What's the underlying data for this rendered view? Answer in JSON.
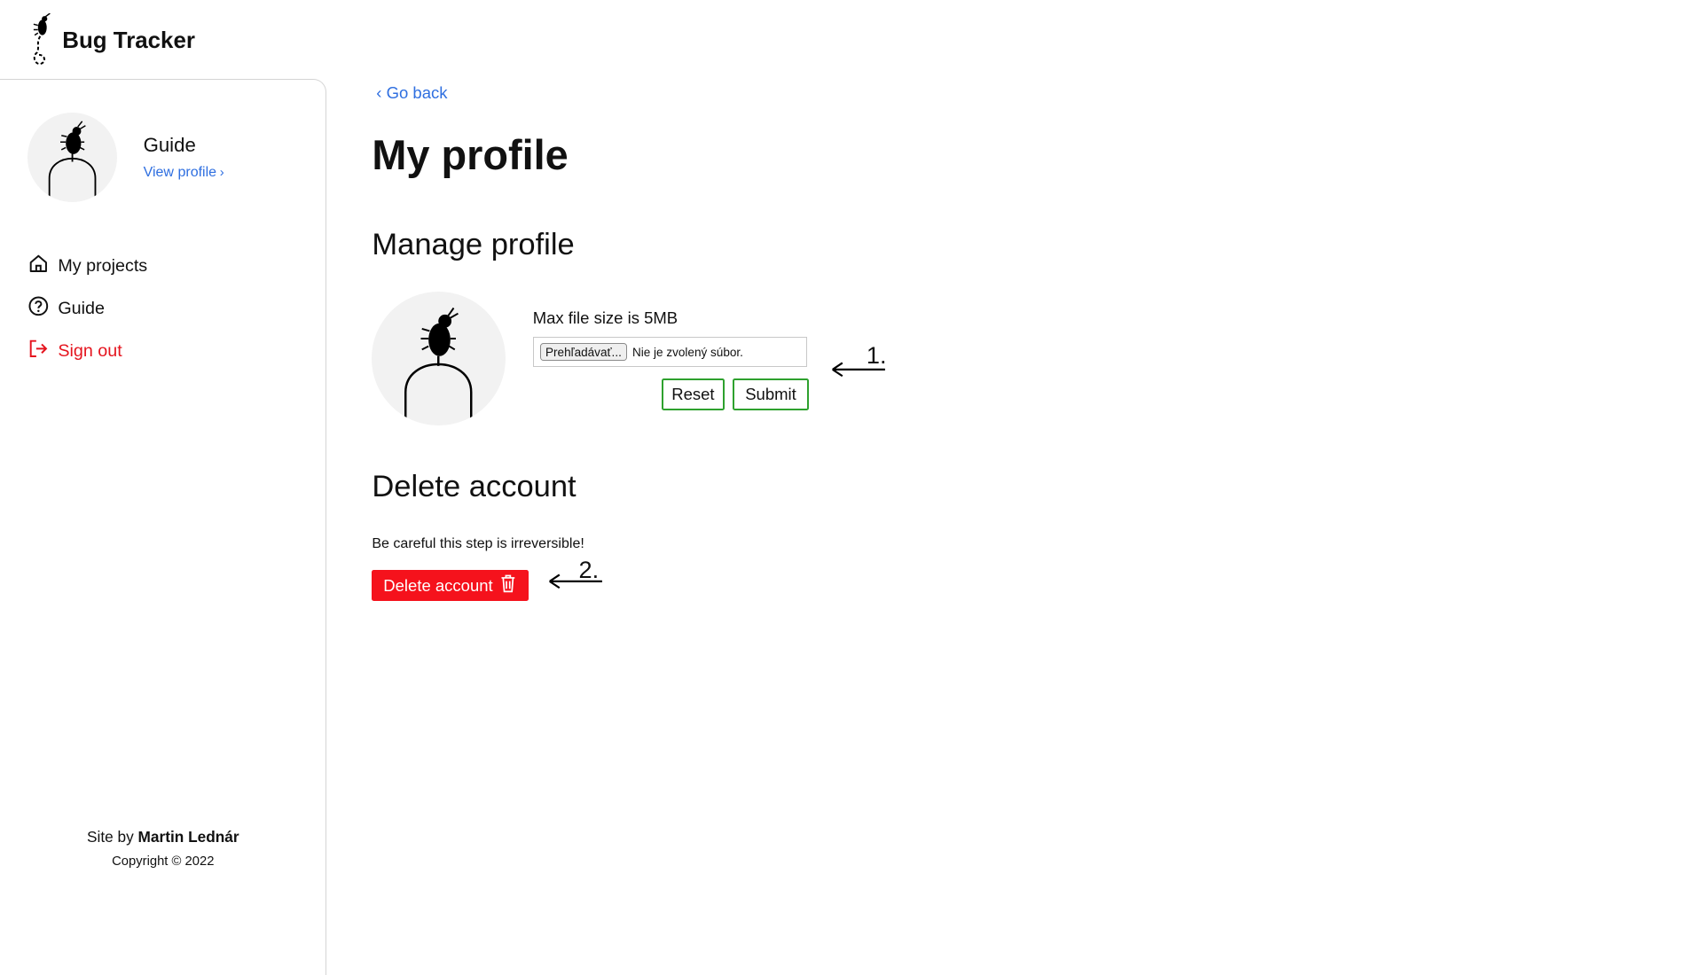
{
  "header": {
    "brand": "Bug Tracker",
    "logo_icon": "bug-logo-icon"
  },
  "sidebar": {
    "user": {
      "name": "Guide",
      "view_profile": "View profile",
      "avatar_icon": "bug-avatar-icon"
    },
    "nav": [
      {
        "label": "My projects",
        "icon": "home-icon"
      },
      {
        "label": "Guide",
        "icon": "help-circle-icon"
      },
      {
        "label": "Sign out",
        "icon": "sign-out-icon",
        "color": "#e5141e"
      }
    ],
    "footer": {
      "site_by": "Site by",
      "author": "Martin Lednár",
      "copyright": "Copyright © 2022"
    }
  },
  "main": {
    "go_back": "Go back",
    "title": "My profile",
    "manage": {
      "title": "Manage profile",
      "file_hint": "Max file size is 5MB",
      "browse_label": "Prehľadávať...",
      "no_file": "Nie je zvolený súbor.",
      "reset_label": "Reset",
      "submit_label": "Submit"
    },
    "delete": {
      "title": "Delete account",
      "note": "Be careful this step is irreversible!",
      "button_label": "Delete account",
      "button_icon": "trash-icon"
    }
  },
  "annotations": [
    {
      "label": "1."
    },
    {
      "label": "2."
    }
  ],
  "colors": {
    "link": "#2f6fe0",
    "danger": "#e5141e",
    "delete_button": "#f5121c",
    "outline_button": "#2ea12e",
    "avatar_bg": "#f2f2f2"
  }
}
